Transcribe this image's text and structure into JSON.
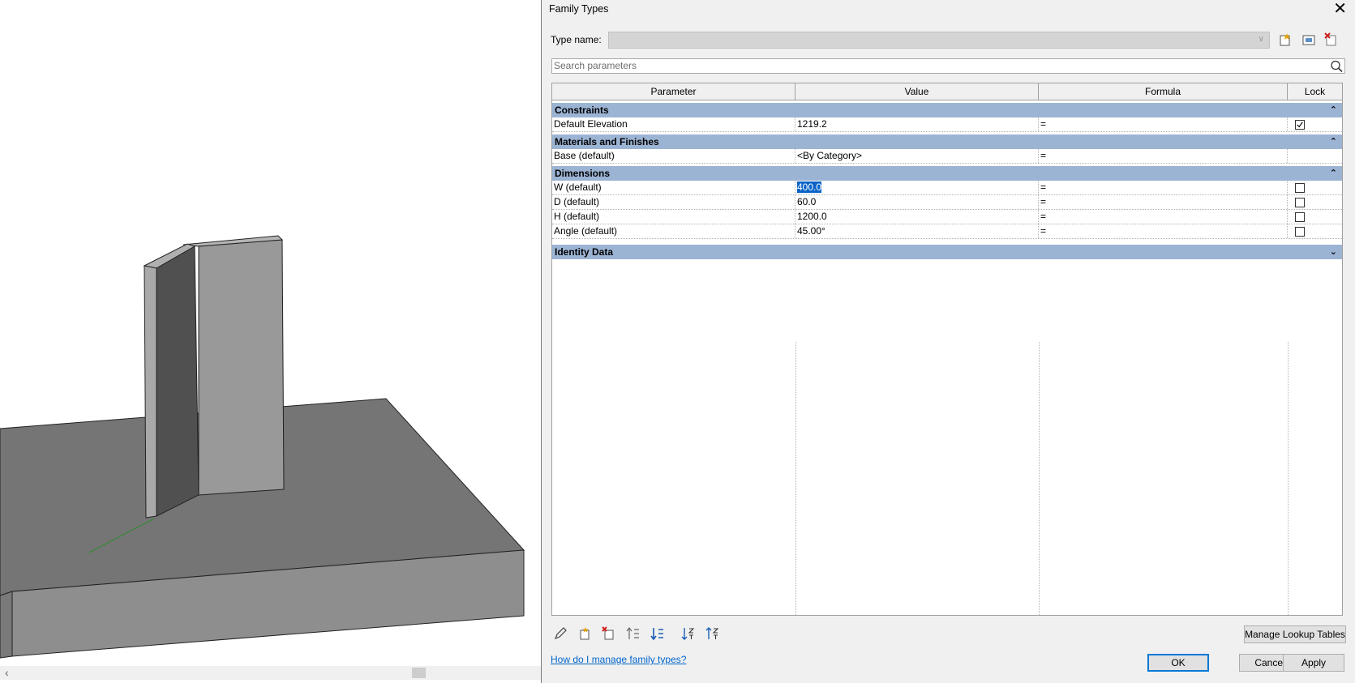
{
  "dialog": {
    "title": "Family Types",
    "type_name_label": "Type name:",
    "type_name_value": "",
    "search_placeholder": "Search parameters",
    "columns": {
      "parameter": "Parameter",
      "value": "Value",
      "formula": "Formula",
      "lock": "Lock"
    },
    "groups": {
      "constraints": {
        "label": "Constraints",
        "rows": [
          {
            "parameter": "Default Elevation",
            "value": "1219.2",
            "formula": "=",
            "locked": true
          }
        ]
      },
      "materials": {
        "label": "Materials and Finishes",
        "rows": [
          {
            "parameter": "Base (default)",
            "value": "<By Category>",
            "formula": "="
          }
        ]
      },
      "dimensions": {
        "label": "Dimensions",
        "rows": [
          {
            "parameter": "W (default)",
            "value": "400.0",
            "formula": "=",
            "locked": false,
            "selected": true
          },
          {
            "parameter": "D (default)",
            "value": "60.0",
            "formula": "=",
            "locked": false
          },
          {
            "parameter": "H (default)",
            "value": "1200.0",
            "formula": "=",
            "locked": false
          },
          {
            "parameter": "Angle (default)",
            "value": "45.00°",
            "formula": "=",
            "locked": false
          }
        ]
      },
      "identity": {
        "label": "Identity Data"
      }
    },
    "manage_lookup_label": "Manage Lookup Tables",
    "help_link": "How do I manage family types?",
    "ok_label": "OK",
    "cancel_label": "Cancel",
    "apply_label": "Apply"
  },
  "icons": [
    "pencil-icon",
    "new-parameter-icon",
    "delete-parameter-icon",
    "move-up-icon",
    "move-down-icon",
    "sort-ascending-icon",
    "sort-descending-icon",
    "search-icon",
    "close-icon",
    "new-type-icon",
    "rename-type-icon",
    "delete-type-icon"
  ],
  "colors": {
    "group_header": "#9cb4d4",
    "selection": "#0a64c8",
    "link": "#0066cc",
    "ok_border": "#0078d7"
  }
}
